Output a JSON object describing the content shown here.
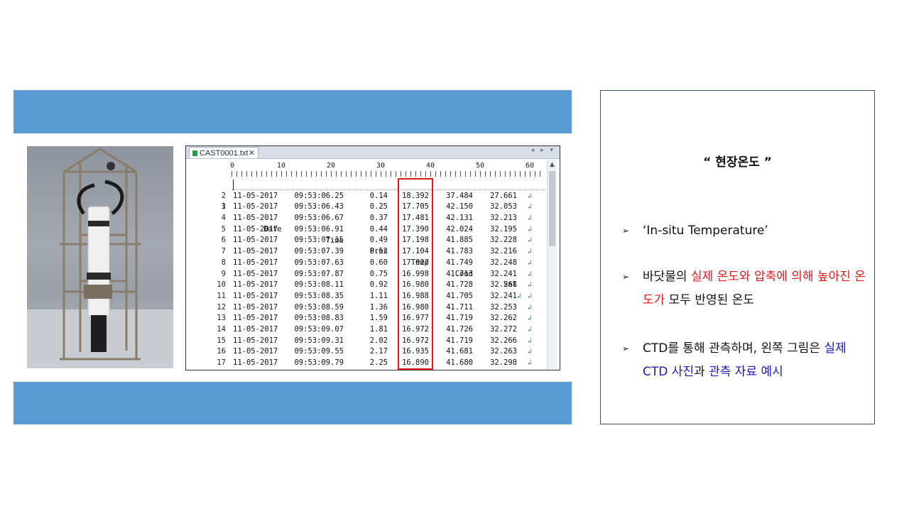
{
  "panel": {
    "title": "“ 현장온도 ”",
    "bullets": [
      {
        "arrow": "➢",
        "text": "‘In-situ Temperature’"
      },
      {
        "arrow": "➢",
        "b2_a": "바닷물의 ",
        "b2_b": "실제 온도와 압축에 의해 높아진 온도가",
        "b2_c": " 모두 반영된 온도"
      },
      {
        "arrow": "➢",
        "b3_a": "CTD를 통해 관측하며, 왼쪽 그림은 ",
        "b3_b": "실제 CTD 사진",
        "b3_c": "과 ",
        "b3_d": "관측 자료 예시"
      }
    ]
  },
  "editor": {
    "tab_label": "CAST0001.txt",
    "tab_close": "✕",
    "nav_arrows": "◂ ▸ ▾",
    "ruler": [
      "0",
      "10",
      "20",
      "30",
      "40",
      "50",
      "60"
    ],
    "header": {
      "num": "1",
      "date": "Date",
      "time": "Time",
      "pres": "Pres",
      "temp": "Temp",
      "cond": "Cond",
      "sal": "Sal"
    },
    "rows": [
      {
        "n": "2",
        "date": "11-05-2017",
        "time": "09:53:06.25",
        "pres": "0.14",
        "temp": "18.392",
        "cond": "37.484",
        "sal": "27.661"
      },
      {
        "n": "3",
        "date": "11-05-2017",
        "time": "09:53:06.43",
        "pres": "0.25",
        "temp": "17.705",
        "cond": "42.150",
        "sal": "32.053"
      },
      {
        "n": "4",
        "date": "11-05-2017",
        "time": "09:53:06.67",
        "pres": "0.37",
        "temp": "17.481",
        "cond": "42.131",
        "sal": "32.213"
      },
      {
        "n": "5",
        "date": "11-05-2017",
        "time": "09:53:06.91",
        "pres": "0.44",
        "temp": "17.390",
        "cond": "42.024",
        "sal": "32.195"
      },
      {
        "n": "6",
        "date": "11-05-2017",
        "time": "09:53:07.15",
        "pres": "0.49",
        "temp": "17.198",
        "cond": "41.885",
        "sal": "32.228"
      },
      {
        "n": "7",
        "date": "11-05-2017",
        "time": "09:53:07.39",
        "pres": "0.52",
        "temp": "17.104",
        "cond": "41.783",
        "sal": "32.216"
      },
      {
        "n": "8",
        "date": "11-05-2017",
        "time": "09:53:07.63",
        "pres": "0.60",
        "temp": "17.027",
        "cond": "41.749",
        "sal": "32.248"
      },
      {
        "n": "9",
        "date": "11-05-2017",
        "time": "09:53:07.87",
        "pres": "0.75",
        "temp": "16.998",
        "cond": "41.713",
        "sal": "32.241"
      },
      {
        "n": "10",
        "date": "11-05-2017",
        "time": "09:53:08.11",
        "pres": "0.92",
        "temp": "16.980",
        "cond": "41.728",
        "sal": "32.268"
      },
      {
        "n": "11",
        "date": "11-05-2017",
        "time": "09:53:08.35",
        "pres": "1.11",
        "temp": "16.988",
        "cond": "41.705",
        "sal": "32.241"
      },
      {
        "n": "12",
        "date": "11-05-2017",
        "time": "09:53:08.59",
        "pres": "1.36",
        "temp": "16.980",
        "cond": "41.711",
        "sal": "32.253"
      },
      {
        "n": "13",
        "date": "11-05-2017",
        "time": "09:53:08.83",
        "pres": "1.59",
        "temp": "16.977",
        "cond": "41.719",
        "sal": "32.262"
      },
      {
        "n": "14",
        "date": "11-05-2017",
        "time": "09:53:09.07",
        "pres": "1.81",
        "temp": "16.972",
        "cond": "41.726",
        "sal": "32.272"
      },
      {
        "n": "15",
        "date": "11-05-2017",
        "time": "09:53:09.31",
        "pres": "2.02",
        "temp": "16.972",
        "cond": "41.719",
        "sal": "32.266"
      },
      {
        "n": "16",
        "date": "11-05-2017",
        "time": "09:53:09.55",
        "pres": "2.17",
        "temp": "16.935",
        "cond": "41.681",
        "sal": "32.263"
      },
      {
        "n": "17",
        "date": "11-05-2017",
        "time": "09:53:09.79",
        "pres": "2.25",
        "temp": "16.890",
        "cond": "41.680",
        "sal": "32.298"
      }
    ],
    "line_end_glyph": "↲"
  },
  "colors": {
    "band": "#5b9bd5",
    "highlight": "#e0191e",
    "accent_blue": "#1a1ab8"
  }
}
